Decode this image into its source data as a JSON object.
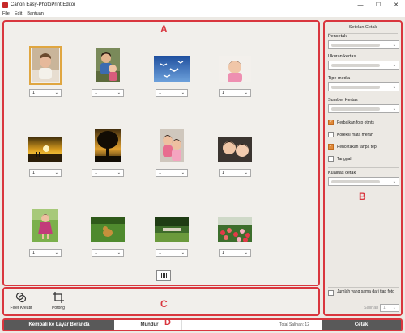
{
  "window": {
    "title": "Canon Easy-PhotoPrint Editor",
    "minimize": "—",
    "maximize": "☐",
    "close": "✕"
  },
  "menu": [
    "File",
    "Edit",
    "Bantuan"
  ],
  "region_labels": {
    "a": "A",
    "b": "B",
    "c": "C",
    "d": "D"
  },
  "photos": [
    {
      "copies": "1",
      "desc": "baby"
    },
    {
      "copies": "1",
      "desc": "mother-child"
    },
    {
      "copies": "1",
      "desc": "birds-sky"
    },
    {
      "copies": "1",
      "desc": "baby-pink"
    },
    {
      "copies": "1",
      "desc": "sunset-beach"
    },
    {
      "copies": "1",
      "desc": "tree-sunset"
    },
    {
      "copies": "1",
      "desc": "children-pink"
    },
    {
      "copies": "1",
      "desc": "girls-close"
    },
    {
      "copies": "1",
      "desc": "child-dress"
    },
    {
      "copies": "1",
      "desc": "dog-grass"
    },
    {
      "copies": "1",
      "desc": "garden-park"
    },
    {
      "copies": "1",
      "desc": "flowers"
    }
  ],
  "tools": {
    "filter": "Filter Kreatif",
    "crop": "Potong"
  },
  "panel": {
    "title": "Setelan Cetak",
    "printer_label": "Pencetak:",
    "paper_size_label": "Ukuran kertas",
    "media_label": "Tipe media",
    "source_label": "Sumber Kertas",
    "options": [
      {
        "label": "Perbaikan foto otmts",
        "checked": true
      },
      {
        "label": "Koreksi mata merah",
        "checked": false
      },
      {
        "label": "Pencetakan tanpa tepi",
        "checked": true
      },
      {
        "label": "Tanggal",
        "checked": false
      }
    ],
    "quality_label": "Kualitas cetak",
    "same_copies": "Jumlah yang sama dari tiap foto",
    "copies_label": "Salinan",
    "copies_value": "1"
  },
  "bottom": {
    "home": "Kembali ke Layar Beranda",
    "back": "Mundur",
    "total": "Total Salinan: 12",
    "print": "Cetak"
  },
  "colors": {
    "frame": "#d9363e",
    "selected": "#e0a640",
    "button": "#595959",
    "checkbox_on": "#e08a3a"
  }
}
